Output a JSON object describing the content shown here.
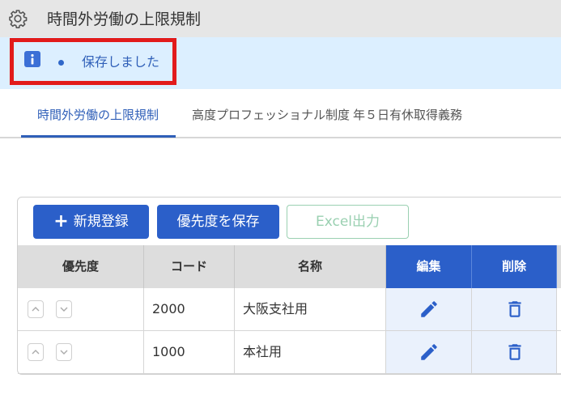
{
  "header": {
    "title": "時間外労働の上限規制",
    "icon": "gear-icon"
  },
  "notice": {
    "message": "保存しました",
    "icon": "info-icon",
    "color": "#2f5fb8",
    "frame_color": "#e21b1b"
  },
  "tabs": [
    {
      "label": "時間外労働の上限規制",
      "active": true
    },
    {
      "label": "高度プロフェッショナル制度",
      "active": false
    },
    {
      "label": "年５日有休取得義務",
      "active": false
    }
  ],
  "toolbar": {
    "new_label": "新規登録",
    "save_priority_label": "優先度を保存",
    "excel_label": "Excel出力"
  },
  "table": {
    "columns": [
      "優先度",
      "コード",
      "名称",
      "編集",
      "削除"
    ],
    "rows": [
      {
        "code": "2000",
        "name": "大阪支社用"
      },
      {
        "code": "1000",
        "name": "本社用"
      }
    ]
  },
  "colors": {
    "primary": "#2b5fc9",
    "accent_text": "#2f5fb8",
    "notice_bg": "#dcefff",
    "disabled_green": "#9ad0b1"
  }
}
